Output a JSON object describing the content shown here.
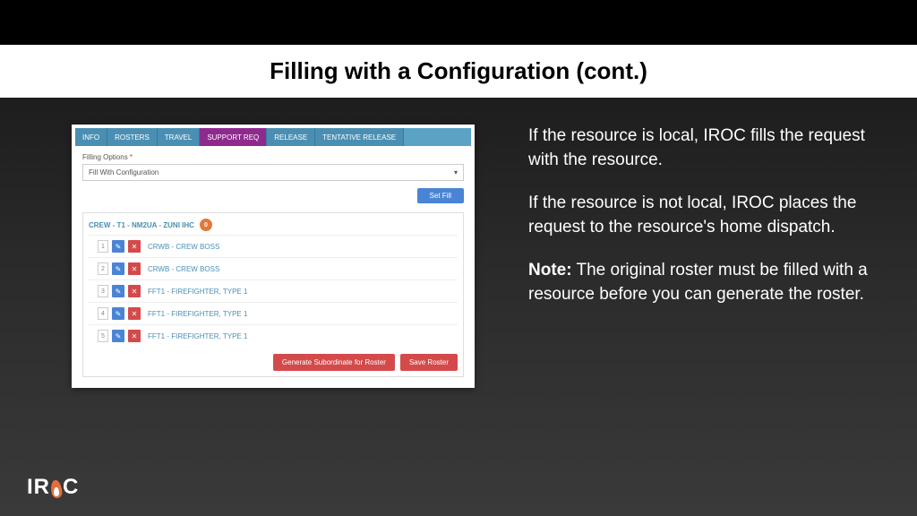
{
  "slide": {
    "title": "Filling with a Configuration (cont.)"
  },
  "app": {
    "tabs": [
      "INFO",
      "ROSTERS",
      "TRAVEL",
      "SUPPORT REQ",
      "RELEASE",
      "TENTATIVE RELEASE"
    ],
    "active_tab_index": 3,
    "filling_label": "Filling Options",
    "filling_value": "Fill With Configuration",
    "set_fill_label": "Set Fill",
    "crew_header": "CREW - T1 - NM2UA - ZUNI IHC",
    "crew_badge": "0",
    "rows": [
      {
        "n": "1",
        "label": "CRWB - CREW BOSS"
      },
      {
        "n": "2",
        "label": "CRWB - CREW BOSS"
      },
      {
        "n": "3",
        "label": "FFT1 - FIREFIGHTER, TYPE 1"
      },
      {
        "n": "4",
        "label": "FFT1 - FIREFIGHTER, TYPE 1"
      },
      {
        "n": "5",
        "label": "FFT1 - FIREFIGHTER, TYPE 1"
      }
    ],
    "gen_sub_label": "Generate Subordinate for Roster",
    "save_roster_label": "Save Roster"
  },
  "copy": {
    "p1": "If the resource is local, IROC fills the request with the resource.",
    "p2": "If the resource is not local, IROC places the request to the resource's home dispatch.",
    "note_label": "Note:",
    "note_body": " The original roster must be filled with a resource before you can generate the roster."
  },
  "logo": {
    "pre": "IR",
    "post": "C"
  }
}
